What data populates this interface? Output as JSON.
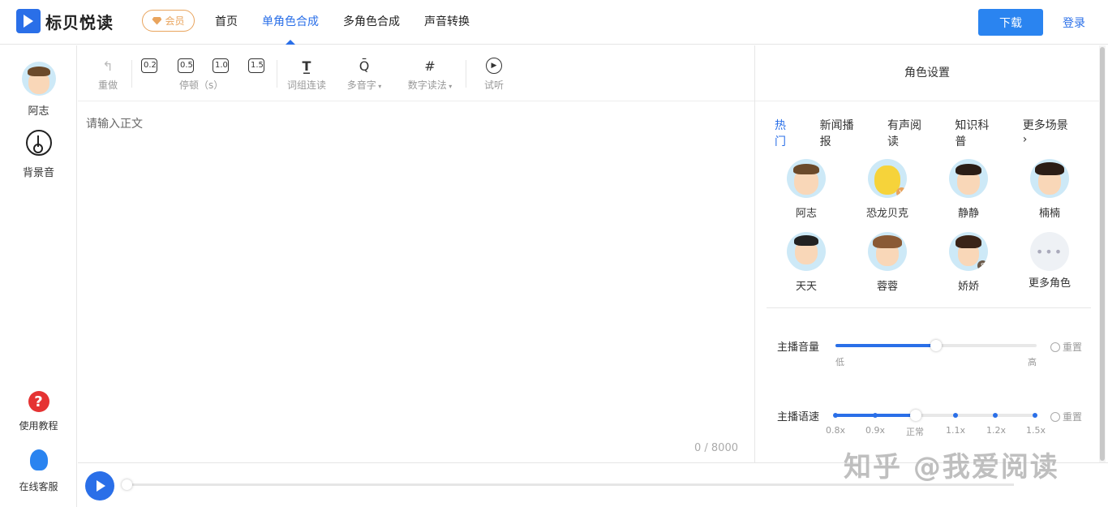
{
  "header": {
    "logo_text": "标贝悦读",
    "vip_label": "会员",
    "nav": [
      {
        "label": "首页",
        "active": false
      },
      {
        "label": "单角色合成",
        "active": true
      },
      {
        "label": "多角色合成",
        "active": false
      },
      {
        "label": "声音转换",
        "active": false
      }
    ],
    "download_label": "下载",
    "login_label": "登录"
  },
  "sidebar": {
    "current_voice": "阿志",
    "bgm_label": "背景音",
    "help_label": "使用教程",
    "support_label": "在线客服"
  },
  "toolbar": {
    "redo_label": "重做",
    "pause_values": [
      "0.2",
      "0.5",
      "1.0",
      "1.5"
    ],
    "pause_label": "停顿（s）",
    "phrase_label": "词组连读",
    "polyphone_label": "多音字",
    "number_label": "数字读法",
    "listen_label": "试听"
  },
  "editor": {
    "placeholder": "请输入正文",
    "char_count": "0 / 8000"
  },
  "role_panel": {
    "title": "角色设置",
    "tabs": [
      {
        "label": "热门",
        "active": true
      },
      {
        "label": "新闻播报",
        "active": false
      },
      {
        "label": "有声阅读",
        "active": false
      },
      {
        "label": "知识科普",
        "active": false
      },
      {
        "label": "更多场景 ›",
        "active": false
      }
    ],
    "voices": [
      {
        "name": "阿志"
      },
      {
        "name": "恐龙贝克",
        "badge": "V"
      },
      {
        "name": "静静"
      },
      {
        "name": "楠楠"
      },
      {
        "name": "天天"
      },
      {
        "name": "蓉蓉"
      },
      {
        "name": "娇娇",
        "badge": "S"
      },
      {
        "name": "更多角色"
      }
    ],
    "volume": {
      "label": "主播音量",
      "low": "低",
      "high": "高",
      "value_fraction": 0.5,
      "reset": "重置"
    },
    "speed": {
      "label": "主播语速",
      "ticks": [
        "0.8x",
        "0.9x",
        "正常",
        "1.1x",
        "1.2x",
        "1.5x"
      ],
      "selected": "正常",
      "reset": "重置"
    }
  },
  "watermark": "知乎 @我爱阅读",
  "colors": {
    "accent": "#2a6fe8",
    "vip": "#e9a45d",
    "help": "#e53333"
  }
}
